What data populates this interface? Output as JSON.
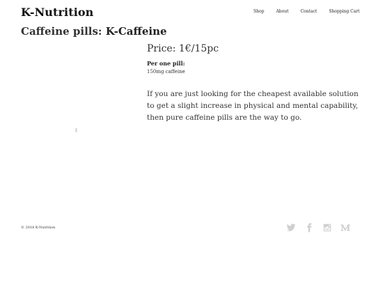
{
  "header": {
    "brand": "K-Nutrition",
    "nav": [
      "Shop",
      "About",
      "Contact",
      "Shopping Cart"
    ]
  },
  "product": {
    "category_prefix": "Caffeine pills:",
    "name": "K-Caffeine",
    "price": "Price: 1€/15pc",
    "per_pill_label": "Per one pill:",
    "ingredient": "150mg caffeine",
    "description": "If you are just looking for the cheapest available solution to get a slight increase in physical and mental capability, then pure caffeine pills are the way to go."
  },
  "footer": {
    "copyright": "© 2018 K-Nutrition",
    "social_icons": [
      "twitter-icon",
      "facebook-icon",
      "instagram-icon",
      "medium-icon"
    ]
  }
}
